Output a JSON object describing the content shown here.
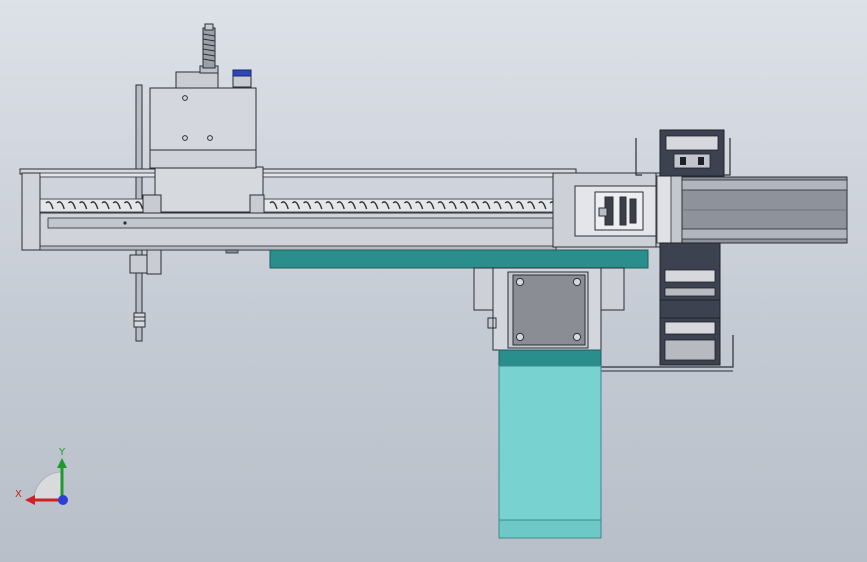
{
  "scene": {
    "colors": {
      "background_top": "#dde1e8",
      "background_bottom": "#b9bfc8",
      "frame": "#d0d3da",
      "frame_dark": "#a9adb5",
      "outline": "#2c2f36",
      "teal_plate": "#2a8e8c",
      "teal_body": "#78d2d0",
      "motor_grey": "#8a8d93",
      "chain_dark": "#3d4250",
      "rail_grey": "#8e939b"
    }
  },
  "triad": {
    "x_label": "X",
    "y_label": "Y",
    "x_color": "#cc2222",
    "y_color": "#1f9a2e",
    "z_color": "#2a3fd6"
  }
}
